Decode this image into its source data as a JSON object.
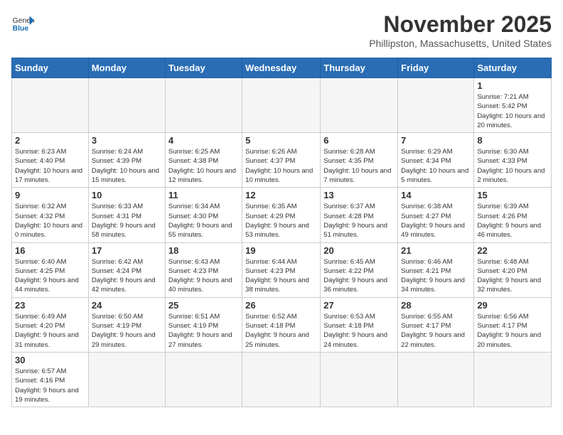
{
  "header": {
    "logo_general": "General",
    "logo_blue": "Blue",
    "month": "November 2025",
    "location": "Phillipston, Massachusetts, United States"
  },
  "weekdays": [
    "Sunday",
    "Monday",
    "Tuesday",
    "Wednesday",
    "Thursday",
    "Friday",
    "Saturday"
  ],
  "days": {
    "1": {
      "sunrise": "7:21 AM",
      "sunset": "5:42 PM",
      "daylight": "10 hours and 20 minutes."
    },
    "2": {
      "sunrise": "6:23 AM",
      "sunset": "4:40 PM",
      "daylight": "10 hours and 17 minutes."
    },
    "3": {
      "sunrise": "6:24 AM",
      "sunset": "4:39 PM",
      "daylight": "10 hours and 15 minutes."
    },
    "4": {
      "sunrise": "6:25 AM",
      "sunset": "4:38 PM",
      "daylight": "10 hours and 12 minutes."
    },
    "5": {
      "sunrise": "6:26 AM",
      "sunset": "4:37 PM",
      "daylight": "10 hours and 10 minutes."
    },
    "6": {
      "sunrise": "6:28 AM",
      "sunset": "4:35 PM",
      "daylight": "10 hours and 7 minutes."
    },
    "7": {
      "sunrise": "6:29 AM",
      "sunset": "4:34 PM",
      "daylight": "10 hours and 5 minutes."
    },
    "8": {
      "sunrise": "6:30 AM",
      "sunset": "4:33 PM",
      "daylight": "10 hours and 2 minutes."
    },
    "9": {
      "sunrise": "6:32 AM",
      "sunset": "4:32 PM",
      "daylight": "10 hours and 0 minutes."
    },
    "10": {
      "sunrise": "6:33 AM",
      "sunset": "4:31 PM",
      "daylight": "9 hours and 58 minutes."
    },
    "11": {
      "sunrise": "6:34 AM",
      "sunset": "4:30 PM",
      "daylight": "9 hours and 55 minutes."
    },
    "12": {
      "sunrise": "6:35 AM",
      "sunset": "4:29 PM",
      "daylight": "9 hours and 53 minutes."
    },
    "13": {
      "sunrise": "6:37 AM",
      "sunset": "4:28 PM",
      "daylight": "9 hours and 51 minutes."
    },
    "14": {
      "sunrise": "6:38 AM",
      "sunset": "4:27 PM",
      "daylight": "9 hours and 49 minutes."
    },
    "15": {
      "sunrise": "6:39 AM",
      "sunset": "4:26 PM",
      "daylight": "9 hours and 46 minutes."
    },
    "16": {
      "sunrise": "6:40 AM",
      "sunset": "4:25 PM",
      "daylight": "9 hours and 44 minutes."
    },
    "17": {
      "sunrise": "6:42 AM",
      "sunset": "4:24 PM",
      "daylight": "9 hours and 42 minutes."
    },
    "18": {
      "sunrise": "6:43 AM",
      "sunset": "4:23 PM",
      "daylight": "9 hours and 40 minutes."
    },
    "19": {
      "sunrise": "6:44 AM",
      "sunset": "4:23 PM",
      "daylight": "9 hours and 38 minutes."
    },
    "20": {
      "sunrise": "6:45 AM",
      "sunset": "4:22 PM",
      "daylight": "9 hours and 36 minutes."
    },
    "21": {
      "sunrise": "6:46 AM",
      "sunset": "4:21 PM",
      "daylight": "9 hours and 34 minutes."
    },
    "22": {
      "sunrise": "6:48 AM",
      "sunset": "4:20 PM",
      "daylight": "9 hours and 32 minutes."
    },
    "23": {
      "sunrise": "6:49 AM",
      "sunset": "4:20 PM",
      "daylight": "9 hours and 31 minutes."
    },
    "24": {
      "sunrise": "6:50 AM",
      "sunset": "4:19 PM",
      "daylight": "9 hours and 29 minutes."
    },
    "25": {
      "sunrise": "6:51 AM",
      "sunset": "4:19 PM",
      "daylight": "9 hours and 27 minutes."
    },
    "26": {
      "sunrise": "6:52 AM",
      "sunset": "4:18 PM",
      "daylight": "9 hours and 25 minutes."
    },
    "27": {
      "sunrise": "6:53 AM",
      "sunset": "4:18 PM",
      "daylight": "9 hours and 24 minutes."
    },
    "28": {
      "sunrise": "6:55 AM",
      "sunset": "4:17 PM",
      "daylight": "9 hours and 22 minutes."
    },
    "29": {
      "sunrise": "6:56 AM",
      "sunset": "4:17 PM",
      "daylight": "9 hours and 20 minutes."
    },
    "30": {
      "sunrise": "6:57 AM",
      "sunset": "4:16 PM",
      "daylight": "9 hours and 19 minutes."
    }
  }
}
